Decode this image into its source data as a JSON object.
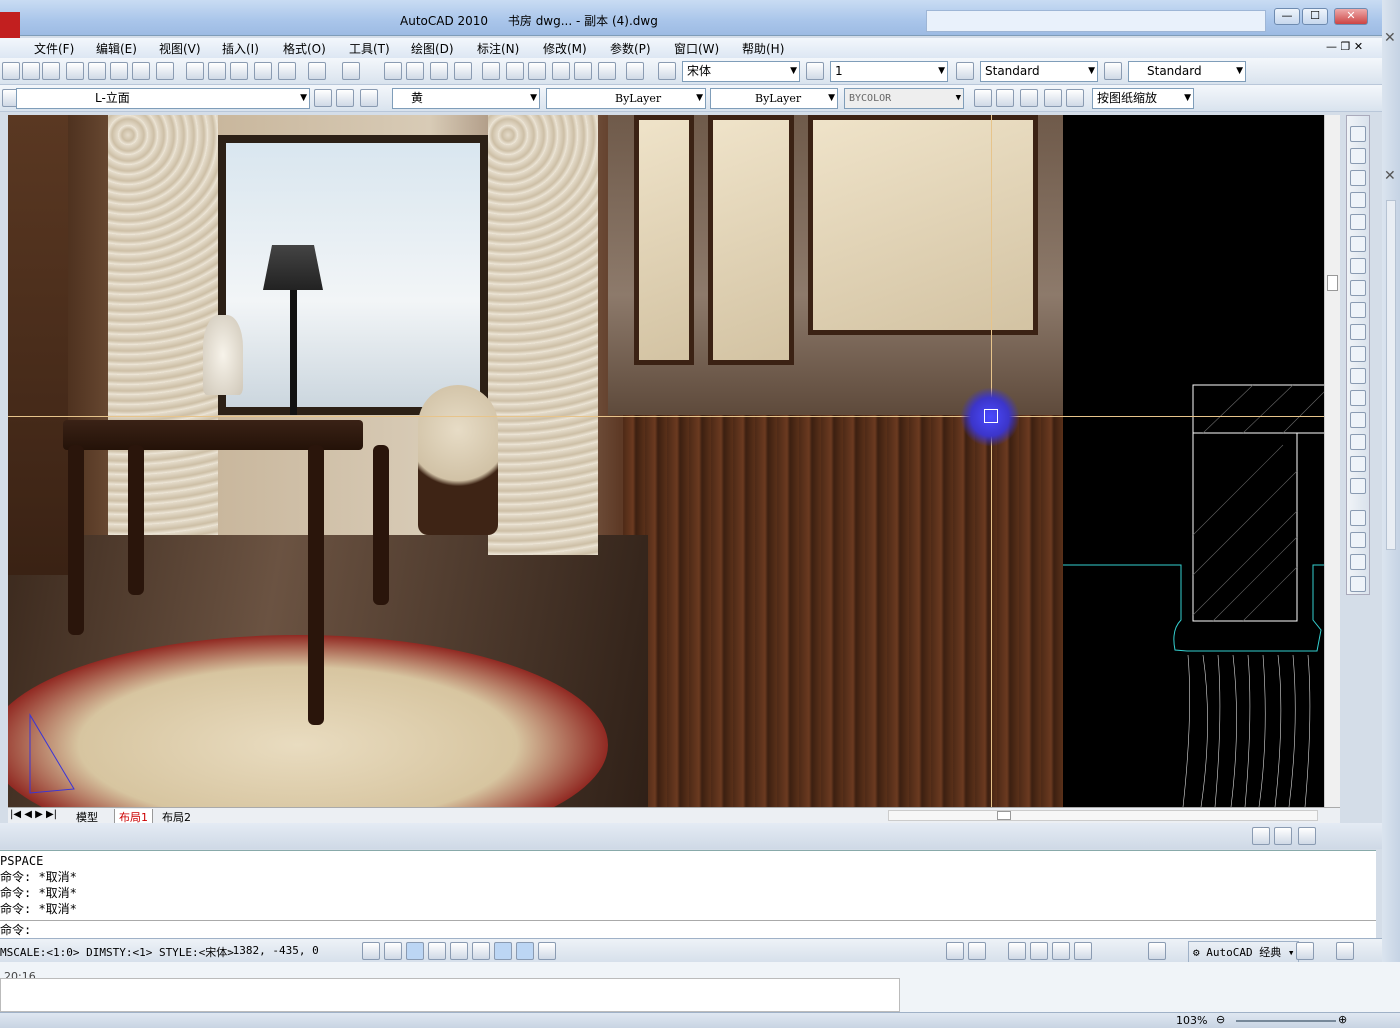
{
  "window": {
    "app_name": "AutoCAD 2010",
    "file_name": "书房 dwg... - 副本 (4).dwg",
    "btn_minimize": "—",
    "btn_maximize": "☐",
    "btn_close": "✕"
  },
  "menu": [
    "文件(F)",
    "编辑(E)",
    "视图(V)",
    "插入(I)",
    "格式(O)",
    "工具(T)",
    "绘图(D)",
    "标注(N)",
    "修改(M)",
    "参数(P)",
    "窗口(W)",
    "帮助(H)"
  ],
  "toolbar1": {
    "text_style": "宋体",
    "dim_scale": "1",
    "dim_style": "Standard",
    "table_style": "Standard"
  },
  "toolbar2": {
    "layer": "L-立面",
    "color": "黄",
    "linetype": "ByLayer",
    "lineweight": "ByLayer",
    "plot_style": "BYCOLOR",
    "viewport_scale": "按图纸缩放"
  },
  "layout_tabs": [
    "模型",
    "布局1",
    "布局2"
  ],
  "command_history": [
    "PSPACE",
    "命令: *取消*",
    "命令: *取消*",
    "命令: *取消*"
  ],
  "command_prompt": "命令:",
  "statusbar": {
    "info": "MSCALE:<1:0> DIMSTY:<1> STYLE:<宋体>",
    "coords": "-1382, -435, 0",
    "workspace": "AutoCAD 经典"
  },
  "bottom": {
    "timestamp": "20:16",
    "zoom": "103%"
  },
  "colors": {
    "title_bar": "#a9c5ea",
    "cad_background": "#000000",
    "crosshair": "#e7c48b",
    "cad_cyan": "#35d0d0"
  }
}
